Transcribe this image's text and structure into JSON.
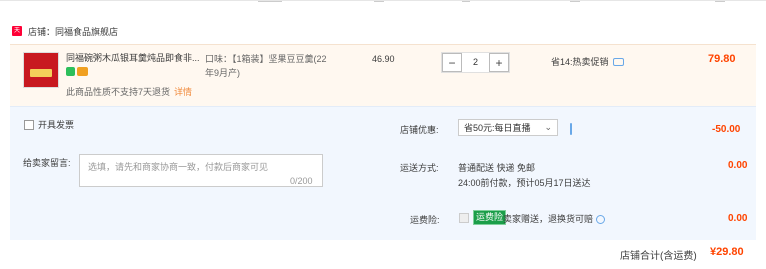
{
  "shop": {
    "icon_label": "天猫",
    "name": "店铺：同福食品旗舰店"
  },
  "item": {
    "title": "同福碗粥木瓜银耳羹炖品即食非...",
    "sku_line1": "口味：【1箱装】坚果豆豆羹(22",
    "sku_line2": "年9月产)",
    "unit_price": "46.90",
    "quantity": "2",
    "minus": "−",
    "plus": "+",
    "promo": "省14:热卖促销",
    "row_price": "79.80",
    "notice": "此商品性质不支持7天退货",
    "notice_link": "详情"
  },
  "invoice": {
    "label": "开具发票"
  },
  "message": {
    "label": "给卖家留言:",
    "placeholder": "选填，请先和商家协商一致，付款后商家可见",
    "count": "0/200"
  },
  "discount": {
    "label": "店铺优惠:",
    "selected": "省50元:每日直播",
    "amount": "-50.00"
  },
  "shipping": {
    "label": "运送方式:",
    "line1": "普通配送 快递 免邮",
    "line2": "24:00前付款，预计05月17日送达",
    "amount": "0.00"
  },
  "insurance": {
    "label": "运费险:",
    "tag": "运费险",
    "text": "卖家赠送，退换货可赔",
    "amount": "0.00"
  },
  "total": {
    "label": "店铺合计(含运费)",
    "value": "¥29.80"
  }
}
